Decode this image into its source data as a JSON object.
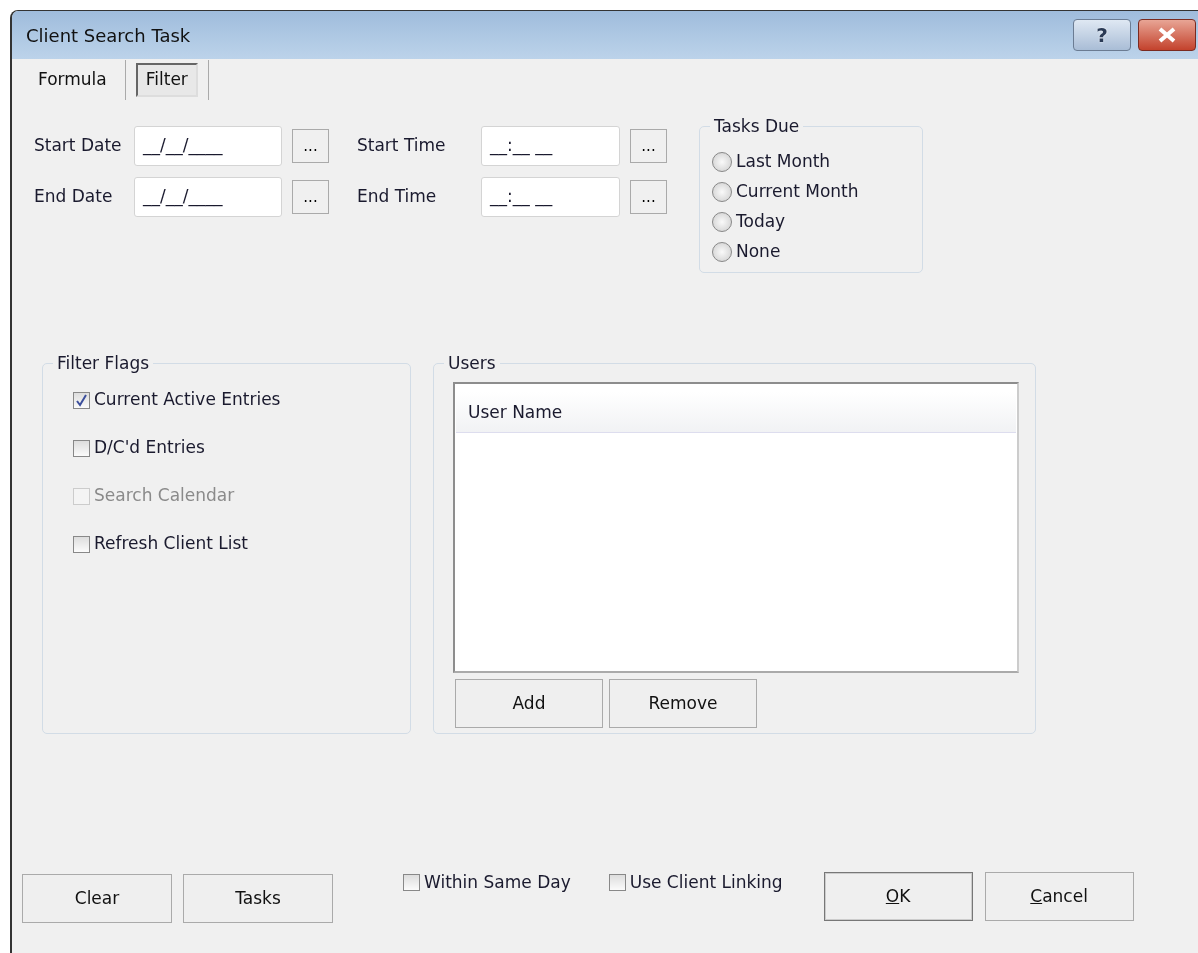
{
  "window": {
    "title": "Client Search Task",
    "controls": [
      {
        "kind": "help",
        "label": "?"
      },
      {
        "kind": "close"
      }
    ]
  },
  "tabs": [
    {
      "label": "Formula",
      "selected": false
    },
    {
      "label": "Filter",
      "selected": true
    }
  ],
  "date_time": [
    {
      "label": "Start Date",
      "mask": "__/__/____",
      "button": "...",
      "time_label": "Start Time",
      "time_mask": "__:__ __",
      "time_button": "..."
    },
    {
      "label": "End Date",
      "mask": "__/__/____",
      "button": "...",
      "time_label": "End Time",
      "time_mask": "__:__ __",
      "time_button": "..."
    }
  ],
  "tasks_due": {
    "title": "Tasks Due",
    "options": [
      {
        "label": "Last Month",
        "selected": false
      },
      {
        "label": "Current Month",
        "selected": false
      },
      {
        "label": "Today",
        "selected": false
      },
      {
        "label": "None",
        "selected": false
      }
    ]
  },
  "filter_flags": {
    "title": "Filter Flags",
    "items": [
      {
        "label": "Current Active Entries",
        "checked": true,
        "disabled": false
      },
      {
        "label": "D/C'd Entries",
        "checked": false,
        "disabled": false
      },
      {
        "label": "Search Calendar",
        "checked": false,
        "disabled": true
      },
      {
        "label": "Refresh Client List",
        "checked": false,
        "disabled": false
      }
    ]
  },
  "users": {
    "title": "Users",
    "columns": [
      "User Name"
    ],
    "buttons": [
      "Add",
      "Remove"
    ]
  },
  "footer": {
    "left_buttons": [
      "Clear",
      "Tasks"
    ],
    "options": [
      {
        "label": "Within Same Day",
        "checked": false
      },
      {
        "label": "Use Client Linking",
        "checked": false
      }
    ],
    "right_buttons": [
      {
        "parts": [
          {
            "text": "O",
            "underlined": true
          },
          {
            "text": "K",
            "underlined": false
          }
        ]
      },
      {
        "parts": [
          {
            "text": "C",
            "underlined": true
          },
          {
            "text": "ancel",
            "underlined": false
          }
        ]
      }
    ]
  }
}
